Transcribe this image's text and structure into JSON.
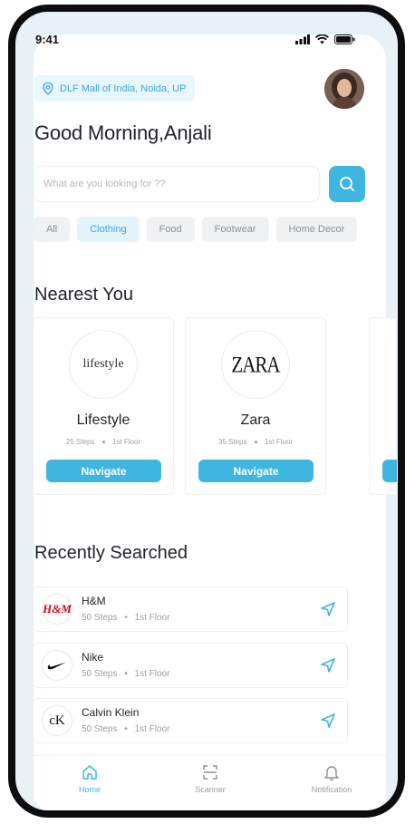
{
  "status": {
    "time": "9:41"
  },
  "location": "DLF Mall of India, Noida, UP",
  "greeting": "Good Morning,Anjali",
  "search": {
    "placeholder": "What are you looking for ??"
  },
  "categories": [
    {
      "label": "All",
      "active": false
    },
    {
      "label": "Clothing",
      "active": true
    },
    {
      "label": "Food",
      "active": false
    },
    {
      "label": "Footwear",
      "active": false
    },
    {
      "label": "Home Decor",
      "active": false
    }
  ],
  "nearest": {
    "title": "Nearest You",
    "stores": [
      {
        "name": "Lifestyle",
        "steps": "25 Steps",
        "floor": "1st Floor",
        "logo_text": "lifestyle",
        "action": "Navigate"
      },
      {
        "name": "Zara",
        "steps": "35 Steps",
        "floor": "1st Floor",
        "logo_text": "ZARA",
        "action": "Navigate"
      }
    ]
  },
  "recent": {
    "title": "Recently Searched",
    "items": [
      {
        "name": "H&M",
        "steps": "50 Steps",
        "floor": "1st Floor",
        "logo_text": "H&M"
      },
      {
        "name": "Nike",
        "steps": "50 Steps",
        "floor": "1st Floor",
        "logo_text": ""
      },
      {
        "name": "Calvin Klein",
        "steps": "50 Steps",
        "floor": "1st Floor",
        "logo_text": "cK"
      }
    ]
  },
  "tabs": [
    {
      "label": "Home",
      "icon": "home-icon",
      "active": true
    },
    {
      "label": "Scanner",
      "icon": "scanner-icon",
      "active": false
    },
    {
      "label": "Notification",
      "icon": "bell-icon",
      "active": false
    }
  ],
  "colors": {
    "accent": "#3fb6e0",
    "chip_active_bg": "#e3f4fb",
    "frame_bg": "#e7f1f6"
  }
}
